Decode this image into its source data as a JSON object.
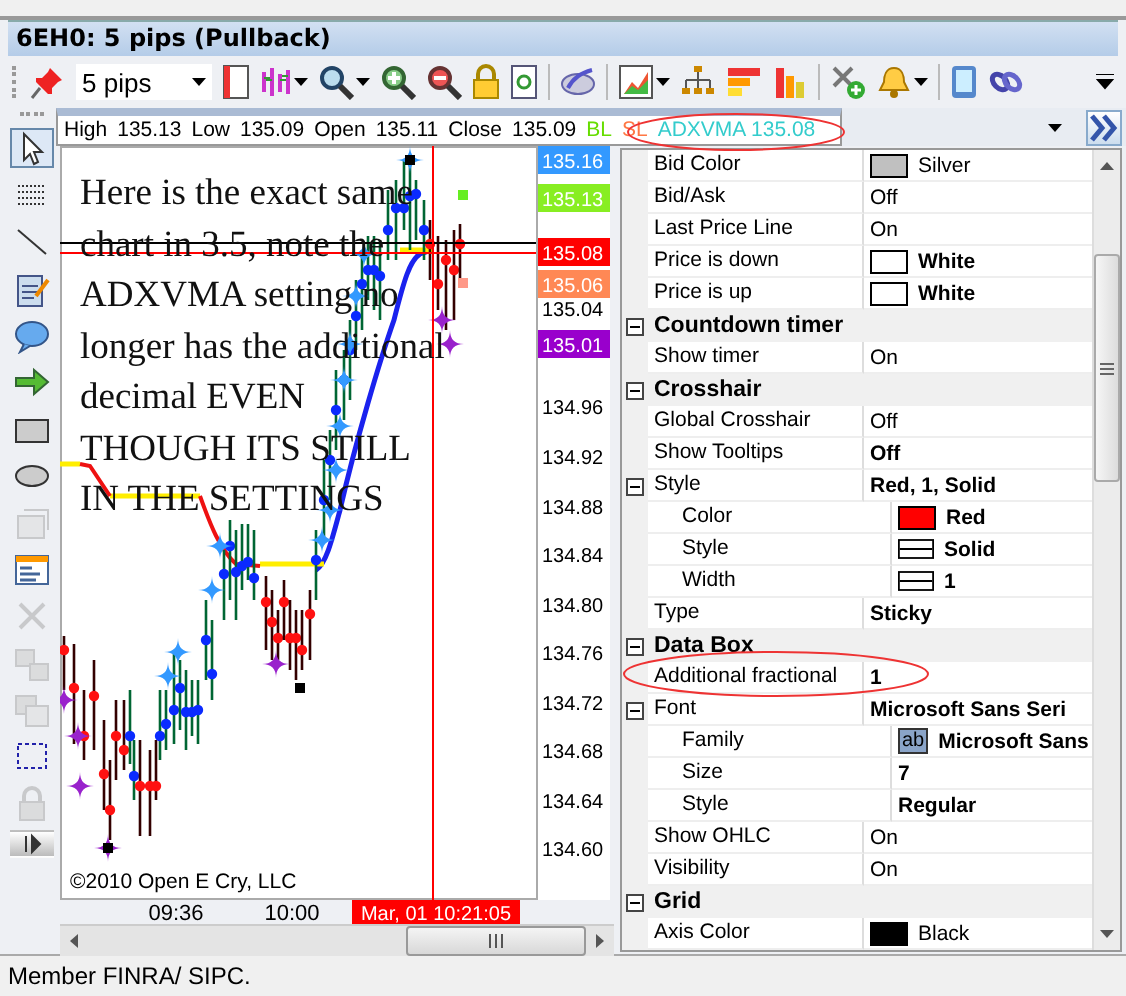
{
  "window": {
    "title": "6EH0: 5 pips (Pullback)"
  },
  "toolbar": {
    "interval": "5 pips"
  },
  "tools": [
    {
      "kind": "pointer",
      "selected": true,
      "disabled": false
    },
    {
      "kind": "dots",
      "selected": false,
      "disabled": false
    },
    {
      "kind": "line",
      "selected": false,
      "disabled": false
    },
    {
      "kind": "note",
      "selected": false,
      "disabled": false
    },
    {
      "kind": "bubble",
      "selected": false,
      "disabled": false
    },
    {
      "kind": "arrow",
      "selected": false,
      "disabled": false
    },
    {
      "kind": "rectangle",
      "selected": false,
      "disabled": false
    },
    {
      "kind": "ellipse",
      "selected": false,
      "disabled": false
    },
    {
      "kind": "window",
      "selected": false,
      "disabled": true
    },
    {
      "kind": "layout",
      "selected": false,
      "disabled": false
    },
    {
      "kind": "delete",
      "selected": false,
      "disabled": true
    },
    {
      "kind": "copy",
      "selected": false,
      "disabled": true
    },
    {
      "kind": "layers",
      "selected": false,
      "disabled": true
    },
    {
      "kind": "select",
      "selected": false,
      "disabled": false
    },
    {
      "kind": "lock",
      "selected": false,
      "disabled": true
    },
    {
      "kind": "expand",
      "selected": false,
      "disabled": false
    }
  ],
  "data_box": {
    "fields": [
      {
        "label": "High",
        "value": "135.13"
      },
      {
        "label": "Low",
        "value": "135.09"
      },
      {
        "label": "Open",
        "value": "135.11"
      },
      {
        "label": "Close",
        "value": "135.09"
      }
    ],
    "indicators": [
      {
        "text": "BL",
        "color": "#66dd00"
      },
      {
        "text": "SL",
        "color": "#ff7744"
      },
      {
        "text": "ADXVMA 135.08",
        "color": "#33cccc"
      }
    ]
  },
  "chart": {
    "note": "Here is the exact same chart in 3.5, note the ADXVMA setting no longer has the additional decimal EVEN THOUGH ITS STILL IN THE SETTINGS",
    "price_tags": [
      {
        "text": "135.16",
        "color": "#3399ff"
      },
      {
        "text": "135.13",
        "color": "#88ee22"
      },
      {
        "text": "135.08",
        "color": "#ff0000"
      },
      {
        "text": "135.06",
        "color": "#ff8855"
      },
      {
        "text": "135.01",
        "color": "#9900cc"
      }
    ],
    "price_ticks": [
      "135.04",
      "134.96",
      "134.92",
      "134.88",
      "134.84",
      "134.80",
      "134.76",
      "134.72",
      "134.68",
      "134.64",
      "134.60"
    ],
    "time_ticks": [
      "09:36",
      "10:00"
    ],
    "cursor_time": "Mar, 01 10:21:05",
    "copyright": "©2010 Open E Cry, LLC"
  },
  "properties": [
    {
      "kind": "property",
      "name": "Bid Color",
      "value": "Silver",
      "bold": false,
      "preview": {
        "kind": "color",
        "color": "#c0c0c0"
      }
    },
    {
      "kind": "property",
      "name": "Bid/Ask",
      "value": "Off",
      "bold": false
    },
    {
      "kind": "property",
      "name": "Last Price Line",
      "value": "On",
      "bold": false
    },
    {
      "kind": "property",
      "name": "Price is down",
      "value": "White",
      "bold": true,
      "preview": {
        "kind": "color",
        "color": "#ffffff"
      }
    },
    {
      "kind": "property",
      "name": "Price is up",
      "value": "White",
      "bold": true,
      "preview": {
        "kind": "color",
        "color": "#ffffff"
      }
    },
    {
      "kind": "category",
      "name": "Countdown timer",
      "expanded": true,
      "children": [
        {
          "kind": "property",
          "name": "Show timer",
          "value": "On",
          "bold": false
        }
      ]
    },
    {
      "kind": "category",
      "name": "Crosshair",
      "expanded": true,
      "children": [
        {
          "kind": "property",
          "name": "Global Crosshair",
          "value": "Off",
          "bold": false
        },
        {
          "kind": "property",
          "name": "Show Tooltips",
          "value": "Off",
          "bold": true
        },
        {
          "kind": "property",
          "name": "Style",
          "value": "Red, 1, Solid",
          "bold": true,
          "expanded": true,
          "children": [
            {
              "kind": "property",
              "name": "Color",
              "value": "Red",
              "bold": true,
              "preview": {
                "kind": "color",
                "color": "#ff0000"
              }
            },
            {
              "kind": "property",
              "name": "Style",
              "value": "Solid",
              "bold": true,
              "preview": {
                "kind": "line"
              }
            },
            {
              "kind": "property",
              "name": "Width",
              "value": "1",
              "bold": true,
              "preview": {
                "kind": "line"
              }
            }
          ]
        },
        {
          "kind": "property",
          "name": "Type",
          "value": "Sticky",
          "bold": true
        }
      ]
    },
    {
      "kind": "category",
      "name": "Data Box",
      "expanded": true,
      "children": [
        {
          "kind": "property",
          "name": "Additional fractional",
          "value": "1",
          "bold": true
        },
        {
          "kind": "property",
          "name": "Font",
          "value": "Microsoft Sans Seri",
          "bold": true,
          "expanded": true,
          "children": [
            {
              "kind": "property",
              "name": "Family",
              "value": "Microsoft Sans",
              "bold": true,
              "preview": {
                "kind": "font",
                "text": "ab"
              }
            },
            {
              "kind": "property",
              "name": "Size",
              "value": "7",
              "bold": true
            },
            {
              "kind": "property",
              "name": "Style",
              "value": "Regular",
              "bold": true
            }
          ]
        },
        {
          "kind": "property",
          "name": "Show OHLC",
          "value": "On",
          "bold": false
        },
        {
          "kind": "property",
          "name": "Visibility",
          "value": "On",
          "bold": false
        }
      ]
    },
    {
      "kind": "category",
      "name": "Grid",
      "expanded": true,
      "children": [
        {
          "kind": "property",
          "name": "Axis Color",
          "value": "Black",
          "bold": false,
          "preview": {
            "kind": "color",
            "color": "#000000"
          }
        }
      ]
    }
  ],
  "status_bar": {
    "text": "Member FINRA/ SIPC."
  }
}
